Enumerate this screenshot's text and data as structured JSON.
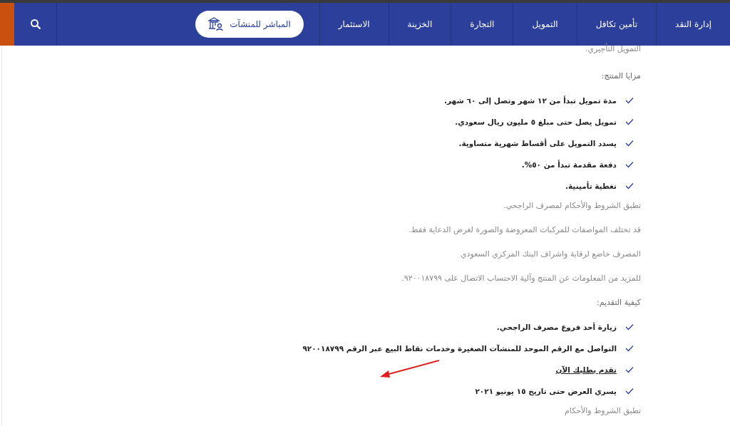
{
  "nav": {
    "items": [
      {
        "label": "إدارة النقد"
      },
      {
        "label": "تأمين تكافل"
      },
      {
        "label": "التمويل"
      },
      {
        "label": "التجارة"
      },
      {
        "label": "الخزينة"
      },
      {
        "label": "الاستثمار"
      }
    ],
    "cta": {
      "label": "المباشر للمنشآت"
    }
  },
  "content": [
    {
      "kind": "text",
      "text": "التمويل التأجيري."
    },
    {
      "kind": "heading",
      "text": "مزايا المنتج:"
    },
    {
      "kind": "list",
      "items": [
        {
          "text": "مدة تمويل تبدأ من ١٢ شهر وتصل إلى ٦٠ شهر."
        },
        {
          "text": "تمويل يصل حتى مبلغ ٥ مليون ريال سعودي."
        },
        {
          "text": "يسدد التمويل على أقساط شهرية متساوية."
        },
        {
          "text": "دفعة مقدمة تبدأ من ٥٠%."
        },
        {
          "text": "تغطية تأمينية."
        }
      ]
    },
    {
      "kind": "text",
      "text": "تطبق الشروط والأحكام لمصرف الراجحي."
    },
    {
      "kind": "text",
      "text": "قد تختلف المواصفات للمركبات المعروضة والصورة لغرض الدعاية فقط."
    },
    {
      "kind": "text",
      "text": "المصرف خاضع لرقابة واشراف البنك المركزي السعودي"
    },
    {
      "kind": "text",
      "text": "للمزيد من المعلومات عن المنتج وآلية الاحتساب الاتصال على ٩٢٠٠١٨٧٩٩."
    },
    {
      "kind": "heading",
      "text": "كيفية التقديم:"
    },
    {
      "kind": "list",
      "items": [
        {
          "text": "زيارة أحد فروع مصرف الراجحي."
        },
        {
          "text": "التواصل مع الرقم الموحد للمنشآت الصغيرة وخدمات نقاط البيع عبر الرقم ٩٢٠٠١٨٧٩٩"
        },
        {
          "text": "تقدم بطلبك الآن",
          "kind": "link",
          "annotated": true
        },
        {
          "text": "يسري العرض حتى تاريخ ١٥ يونيو ٢٠٢١"
        }
      ]
    },
    {
      "kind": "text",
      "text": "تطبق الشروط والأحكام"
    }
  ]
}
